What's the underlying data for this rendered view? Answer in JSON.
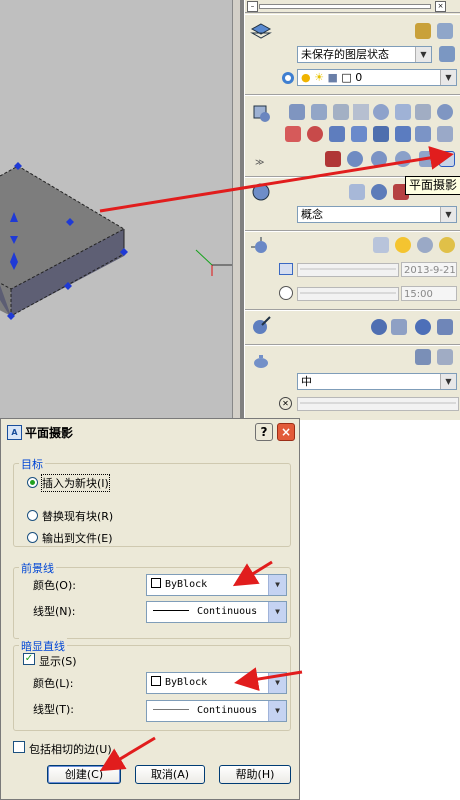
{
  "panel": {
    "layer_state": "未保存的图层状态",
    "layer_combo": "0",
    "visual_style": "概念",
    "date_value": "2013-9-21",
    "time_value": "15:00",
    "render_quality": "中"
  },
  "tooltip": "平面摄影",
  "dialog": {
    "title": "平面摄影",
    "help_btn": "?",
    "close_btn": "×",
    "target": {
      "title": "目标",
      "opt_insert": "插入为新块(I)",
      "opt_replace": "替换现有块(R)",
      "opt_export": "输出到文件(E)"
    },
    "foreground": {
      "title": "前景线",
      "color_label": "颜色(O):",
      "color_value": "ByBlock",
      "linetype_label": "线型(N):",
      "linetype_value": "Continuous"
    },
    "hidden": {
      "title": "暗显直线",
      "show_label": "显示(S)",
      "color_label": "颜色(L):",
      "color_value": "ByBlock",
      "linetype_label": "线型(T):",
      "linetype_value": "Continuous"
    },
    "include_tangent": "包括相切的边(U)",
    "create_btn": "创建(C)",
    "cancel_btn": "取消(A)",
    "help_button": "帮助(H)"
  },
  "colors": {
    "viewport_bg": "#bfbfbf",
    "solid_top": "#7d7d7d",
    "solid_side": "#5c5d73",
    "grip_blue": "#1f3ad6",
    "annotation_red": "#e11d1d"
  }
}
